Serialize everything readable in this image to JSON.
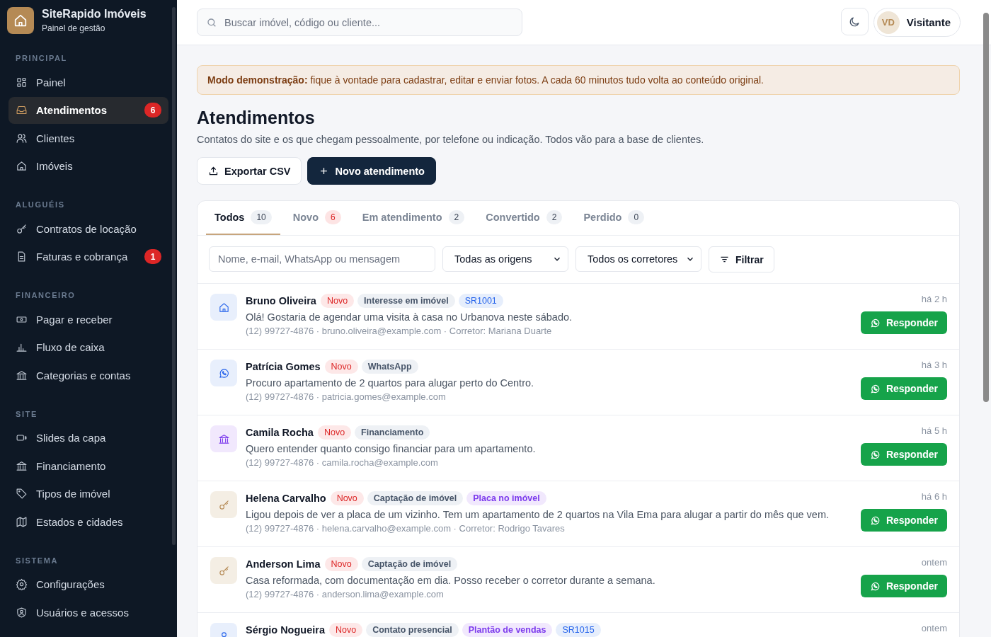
{
  "brand": {
    "name": "SiteRapido Imóveis",
    "subtitle": "Painel de gestão"
  },
  "sidebar": {
    "sections": [
      {
        "label": "PRINCIPAL",
        "items": [
          {
            "label": "Painel",
            "kind": "grid",
            "selected": false
          },
          {
            "label": "Atendimentos",
            "kind": "inbox",
            "selected": true,
            "badge": "6"
          },
          {
            "label": "Clientes",
            "kind": "users",
            "selected": false
          },
          {
            "label": "Imóveis",
            "kind": "house",
            "selected": false
          }
        ]
      },
      {
        "label": "ALUGUÉIS",
        "items": [
          {
            "label": "Contratos de locação",
            "kind": "key",
            "selected": false
          },
          {
            "label": "Faturas e cobrança",
            "kind": "file",
            "selected": false,
            "badge": "1"
          }
        ]
      },
      {
        "label": "FINANCEIRO",
        "items": [
          {
            "label": "Pagar e receber",
            "kind": "cash",
            "selected": false
          },
          {
            "label": "Fluxo de caixa",
            "kind": "chart",
            "selected": false
          },
          {
            "label": "Categorias e contas",
            "kind": "bank",
            "selected": false
          }
        ]
      },
      {
        "label": "SITE",
        "items": [
          {
            "label": "Slides da capa",
            "kind": "video",
            "selected": false
          },
          {
            "label": "Financiamento",
            "kind": "bank",
            "selected": false
          },
          {
            "label": "Tipos de imóvel",
            "kind": "tag",
            "selected": false
          },
          {
            "label": "Estados e cidades",
            "kind": "map",
            "selected": false
          }
        ]
      },
      {
        "label": "SISTEMA",
        "items": [
          {
            "label": "Configurações",
            "kind": "gear",
            "selected": false
          },
          {
            "label": "Usuários e acessos",
            "kind": "shield",
            "selected": false
          }
        ]
      }
    ]
  },
  "header": {
    "search": {
      "placeholder": "Buscar imóvel, código ou cliente..."
    },
    "user": {
      "initials": "VD",
      "name": "Visitante"
    }
  },
  "banner": "**Modo demonstração:** fique à vontade para cadastrar, editar e enviar fotos. A cada 60 minutos tudo volta ao conteúdo original.",
  "page": {
    "title": "Atendimentos",
    "subtitle": "Contatos do site e os que chegam pessoalmente, por telefone ou indicação. Todos vão para a base de clientes."
  },
  "actions": [
    {
      "label": "Exportar CSV",
      "kind": "secondary"
    },
    {
      "label": "Novo atendimento",
      "kind": "primary"
    }
  ],
  "tabs": [
    {
      "label": "Todos",
      "count": "10",
      "selected": true,
      "alert": false
    },
    {
      "label": "Novo",
      "count": "6",
      "selected": false,
      "alert": true
    },
    {
      "label": "Em atendimento",
      "count": "2",
      "selected": false,
      "alert": false
    },
    {
      "label": "Convertido",
      "count": "2",
      "selected": false,
      "alert": false
    },
    {
      "label": "Perdido",
      "count": "0",
      "selected": false,
      "alert": false
    }
  ],
  "filters": {
    "search": {
      "placeholder": "Nome, e-mail, WhatsApp ou mensagem"
    },
    "origin": "Todas as origens",
    "broker": "Todos os corretores",
    "button": "Filtrar"
  },
  "leads": [
    {
      "name": "Bruno Oliveira",
      "kind": "house",
      "tags": [
        {
          "label": "Novo",
          "kind": "status"
        },
        {
          "label": "Interesse em imóvel",
          "kind": "source"
        },
        {
          "label": "SR1001",
          "kind": "code"
        }
      ],
      "message": "Olá! Gostaria de agendar uma visita à casa no Urbanova neste sábado.",
      "meta": "(12) 99727-4876 · bruno.oliveira@example.com · Corretor: Mariana Duarte",
      "time": "há 2 h",
      "action": "Responder"
    },
    {
      "name": "Patrícia Gomes",
      "kind": "whatsapp",
      "tags": [
        {
          "label": "Novo",
          "kind": "status"
        },
        {
          "label": "WhatsApp",
          "kind": "source"
        }
      ],
      "message": "Procuro apartamento de 2 quartos para alugar perto do Centro.",
      "meta": "(12) 99727-4876 · patricia.gomes@example.com",
      "time": "há 3 h",
      "action": "Responder"
    },
    {
      "name": "Camila Rocha",
      "kind": "bank",
      "tags": [
        {
          "label": "Novo",
          "kind": "status"
        },
        {
          "label": "Financiamento",
          "kind": "source"
        }
      ],
      "message": "Quero entender quanto consigo financiar para um apartamento.",
      "meta": "(12) 99727-4876 · camila.rocha@example.com",
      "time": "há 5 h",
      "action": "Responder"
    },
    {
      "name": "Helena Carvalho",
      "kind": "key",
      "tags": [
        {
          "label": "Novo",
          "kind": "status"
        },
        {
          "label": "Captação de imóvel",
          "kind": "source"
        },
        {
          "label": "Placa no imóvel",
          "kind": "extra"
        }
      ],
      "message": "Ligou depois de ver a placa de um vizinho. Tem um apartamento de 2 quartos na Vila Ema para alugar a partir do mês que vem.",
      "meta": "(12) 99727-4876 · helena.carvalho@example.com · Corretor: Rodrigo Tavares",
      "time": "há 6 h",
      "action": "Responder"
    },
    {
      "name": "Anderson Lima",
      "kind": "key",
      "tags": [
        {
          "label": "Novo",
          "kind": "status"
        },
        {
          "label": "Captação de imóvel",
          "kind": "source"
        }
      ],
      "message": "Casa reformada, com documentação em dia. Posso receber o corretor durante a semana.",
      "meta": "(12) 99727-4876 · anderson.lima@example.com",
      "time": "ontem",
      "action": "Responder"
    },
    {
      "name": "Sérgio Nogueira",
      "kind": "user",
      "tags": [
        {
          "label": "Novo",
          "kind": "status"
        },
        {
          "label": "Contato presencial",
          "kind": "source"
        },
        {
          "label": "Plantão de vendas",
          "kind": "extra"
        },
        {
          "label": "SR1015",
          "kind": "code"
        }
      ],
      "time": "ontem"
    }
  ]
}
